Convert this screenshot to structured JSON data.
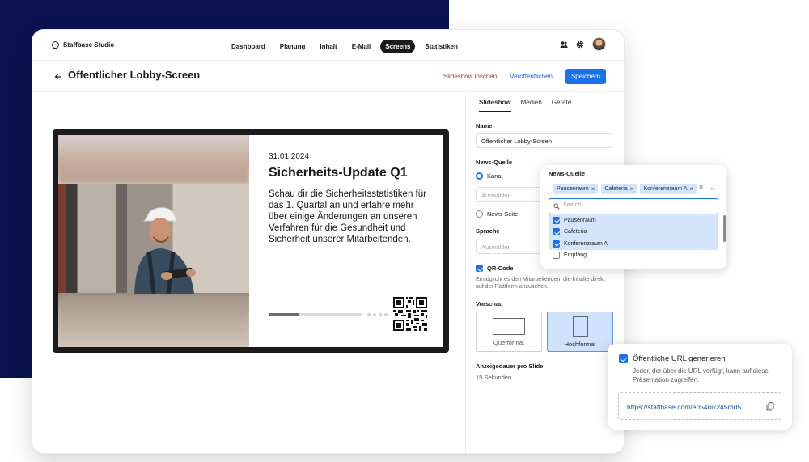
{
  "app": {
    "brand": "Staffbase Studio",
    "nav": [
      "Dashboard",
      "Planung",
      "Inhalt",
      "E-Mail",
      "Screens",
      "Statistiken"
    ],
    "active_nav": "Screens"
  },
  "header": {
    "title": "Öffentlicher Lobby-Screen",
    "delete_label": "Slideshow löschen",
    "publish_label": "Veröffentlichen",
    "save_label": "Speichern"
  },
  "slide": {
    "date": "31.01.2024",
    "title": "Sicherheits-Update Q1",
    "body": "Schau dir die Sicherheitsstatistiken für das 1. Quartal an und erfahre mehr über einige Änderungen an unseren Verfahren für die Gesundheit und Sicherheit unserer Mitarbeitenden.",
    "progress_fraction": 0.33
  },
  "panel": {
    "tabs": [
      "Slideshow",
      "Medien",
      "Geräte"
    ],
    "active_tab": "Slideshow",
    "name_label": "Name",
    "name_value": "Öffentlicher Lobby-Screen",
    "news_source_label": "News-Quelle",
    "radio_channel": "Kanal",
    "channel_placeholder": "Auswählen",
    "radio_news_page": "News-Seite",
    "language_label": "Sprache",
    "language_placeholder": "Auswählen",
    "qr_label": "QR-Code",
    "qr_help": "Ermöglicht es den Mitarbeitenden, die Inhalte direkt auf der Plattform anzusehen.",
    "preview_label": "Vorschau",
    "format_landscape": "Querformat",
    "format_portrait": "Hochformat",
    "duration_label": "Anzeigedauer pro Slide",
    "duration_value": "15 Sekunden"
  },
  "news_popup": {
    "label": "News-Quelle",
    "chips": [
      "Pausenraum",
      "Cafeteria",
      "Konferenzraum A"
    ],
    "search_placeholder": "Search",
    "options": [
      {
        "label": "Pausenraum",
        "checked": true
      },
      {
        "label": "Cafeteria",
        "checked": true
      },
      {
        "label": "Konferenzraum A",
        "checked": true
      },
      {
        "label": "Empfang",
        "checked": false
      }
    ]
  },
  "url_popup": {
    "label": "Öffentliche URL generieren",
    "help": "Jeder, der über die URL verfügt, kann auf diese Präsentation zugreifen.",
    "url": "https://staffbase.com/eri54uix245md5...."
  },
  "colors": {
    "navy": "#0c1250",
    "primary": "#1b72e8",
    "delete": "#9b3826"
  }
}
